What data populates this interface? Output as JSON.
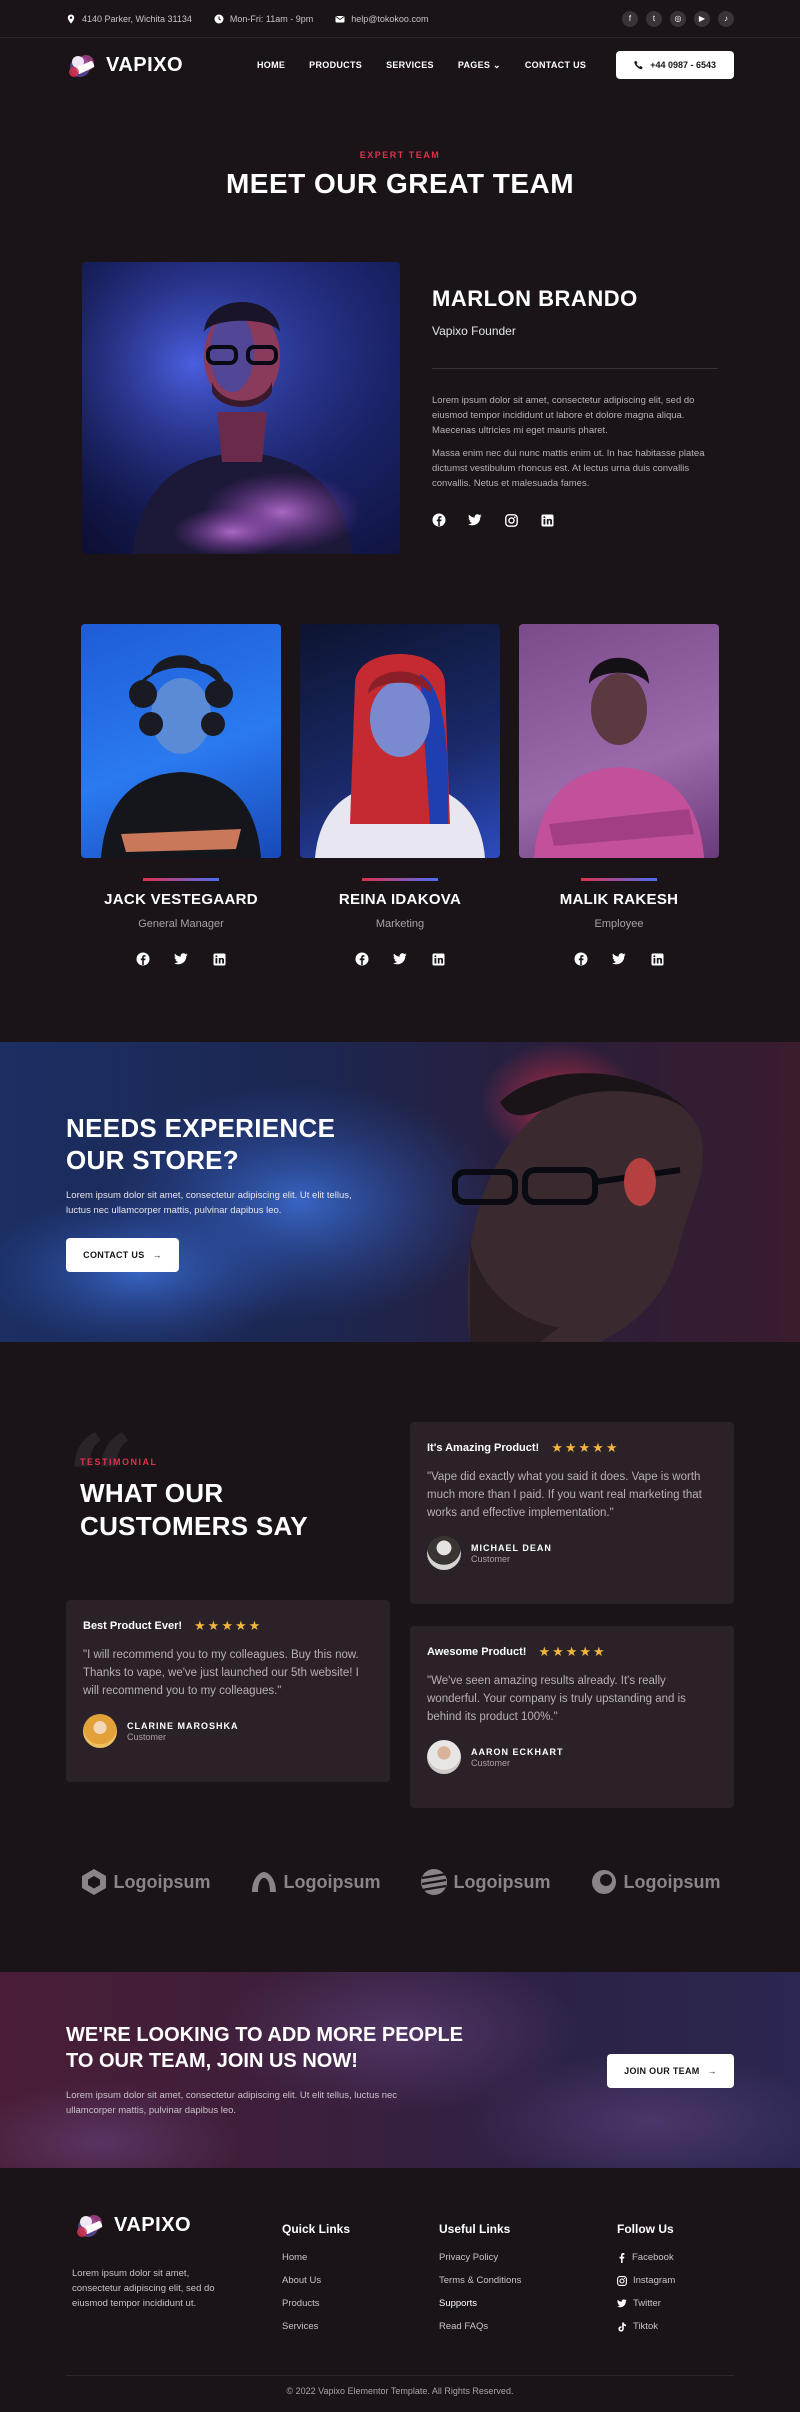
{
  "topbar": {
    "address": "4140 Parker, Wichita 31134",
    "hours": "Mon-Fri: 11am - 9pm",
    "email": "help@tokokoo.com",
    "socials": [
      "facebook-icon",
      "twitter-icon",
      "instagram-icon",
      "youtube-icon",
      "tiktok-icon"
    ]
  },
  "nav": {
    "brand": "VAPIXO",
    "items": [
      "HOME",
      "PRODUCTS",
      "SERVICES",
      "PAGES",
      "CONTACT US"
    ],
    "phone": "+44 0987 - 6543"
  },
  "team": {
    "eyebrow": "EXPERT TEAM",
    "title": "MEET OUR GREAT TEAM",
    "featured": {
      "name": "MARLON BRANDO",
      "role": "Vapixo Founder",
      "p1": "Lorem ipsum dolor sit amet, consectetur adipiscing elit, sed do eiusmod tempor incididunt ut labore et dolore magna aliqua. Maecenas ultricies mi eget mauris pharet.",
      "p2": "Massa enim nec dui nunc mattis enim ut. In hac habitasse platea dictumst vestibulum rhoncus est. At lectus urna duis convallis convallis. Netus et malesuada fames."
    },
    "members": [
      {
        "name": "JACK VESTEGAARD",
        "role": "General Manager"
      },
      {
        "name": "REINA IDAKOVA",
        "role": "Marketing"
      },
      {
        "name": "MALIK RAKESH",
        "role": "Employee"
      }
    ]
  },
  "banner": {
    "title_line1": "NEEDS EXPERIENCE",
    "title_line2": "OUR STORE?",
    "text": "Lorem ipsum dolor sit amet, consectetur adipiscing elit. Ut elit tellus, luctus nec ullamcorper mattis, pulvinar dapibus leo.",
    "button": "CONTACT US"
  },
  "testimonials": {
    "eyebrow": "TESTIMONIAL",
    "title_line1": "WHAT OUR",
    "title_line2": "CUSTOMERS SAY",
    "items": [
      {
        "title": "It's Amazing Product!",
        "stars": "★★★★★",
        "text": "\"Vape did exactly what you said it does. Vape is worth much more than I paid. If you want real marketing that works and effective implementation.\"",
        "name": "MICHAEL DEAN",
        "role": "Customer"
      },
      {
        "title": "Best Product Ever!",
        "stars": "★★★★★",
        "text": "\"I will recommend you to my colleagues. Buy this now. Thanks to vape, we've just launched our 5th website! I will recommend you to my colleagues.\"",
        "name": "CLARINE MAROSHKA",
        "role": "Customer"
      },
      {
        "title": "Awesome Product!",
        "stars": "★★★★★",
        "text": "\"We've seen amazing results already. It's really wonderful. Your company is truly upstanding and is behind its product 100%.\"",
        "name": "AARON ECKHART",
        "role": "Customer"
      }
    ]
  },
  "logos": [
    "Logoipsum",
    "Logoipsum",
    "Logoipsum",
    "Logoipsum"
  ],
  "join": {
    "title": "WE'RE LOOKING TO ADD MORE PEOPLE TO OUR TEAM, JOIN US NOW!",
    "text": "Lorem ipsum dolor sit amet, consectetur adipiscing elit. Ut elit tellus, luctus nec ullamcorper mattis, pulvinar dapibus leo.",
    "button": "JOIN OUR TEAM"
  },
  "footer": {
    "brand": "VAPIXO",
    "desc": "Lorem ipsum dolor sit amet, consectetur adipiscing elit, sed do eiusmod tempor incididunt ut.",
    "quick_title": "Quick Links",
    "quick": [
      "Home",
      "About Us",
      "Products",
      "Services"
    ],
    "useful_title": "Useful Links",
    "useful": [
      "Privacy Policy",
      "Terms & Conditions",
      "Supports",
      "Read FAQs"
    ],
    "follow_title": "Follow Us",
    "follow": [
      "Facebook",
      "Instagram",
      "Twitter",
      "Tiktok"
    ],
    "copyright": "© 2022 Vapixo Elementor Template. All Rights Reserved."
  },
  "colors": {
    "accent": "#e0314c",
    "background": "#1a1419",
    "star": "#f2b53d",
    "card": "#2a2228"
  }
}
